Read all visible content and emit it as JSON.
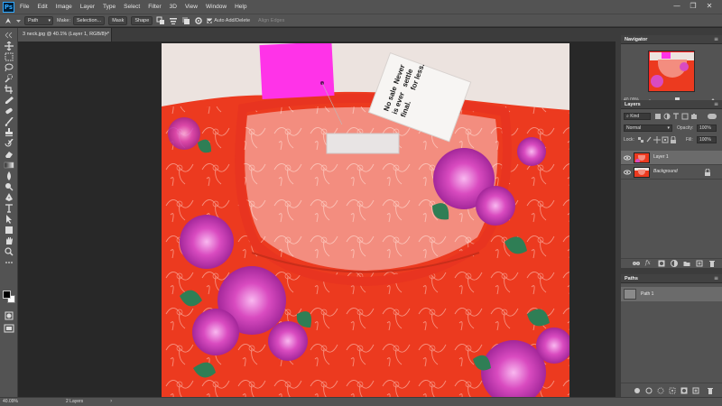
{
  "app": {
    "name": "Photoshop",
    "logo_text": "Ps"
  },
  "menu": [
    "File",
    "Edit",
    "Image",
    "Layer",
    "Type",
    "Select",
    "Filter",
    "3D",
    "View",
    "Window",
    "Help"
  ],
  "window_controls": {
    "minimize": "—",
    "restore": "❐",
    "close": "✕"
  },
  "options_bar": {
    "mode_value": "Path",
    "make_label": "Make:",
    "selection_label": "Selection...",
    "mask_label": "Mask",
    "shape_label": "Shape",
    "auto_add_delete": "Auto Add/Delete",
    "align_edges": "Align Edges"
  },
  "document_tab": {
    "title": "3 neck.jpg @ 40.1% (Layer 1, RGB/8) *"
  },
  "status_bar": {
    "zoom": "40.09%",
    "info": "2 Layers"
  },
  "navigator": {
    "title": "Navigator",
    "zoom": "40.09%"
  },
  "layers": {
    "title": "Layers",
    "filter_kind": "Kind",
    "blend_mode": "Normal",
    "opacity_label": "Opacity:",
    "opacity_value": "100%",
    "lock_label": "Lock:",
    "fill_label": "Fill:",
    "fill_value": "100%",
    "items": [
      {
        "name": "Layer 1",
        "selected": true
      },
      {
        "name": "Background",
        "selected": false
      }
    ],
    "fx_label": "fx"
  },
  "paths": {
    "title": "Paths",
    "items": [
      {
        "name": "Path 1"
      }
    ]
  },
  "artwork": {
    "tag_text_1": "Never",
    "tag_text_2": "settle",
    "tag_text_3": "for less.",
    "tag_text_4": "No sale",
    "tag_text_5": "is ever",
    "tag_text_6": "final."
  },
  "colors": {
    "ui_dark": "#535353",
    "ui_darker": "#3c3c3c",
    "canvas_bg": "#282828",
    "fabric_red": "#ec3a1f",
    "floral_pink": "#d94bc0",
    "tag_magenta": "#ff33e8"
  }
}
